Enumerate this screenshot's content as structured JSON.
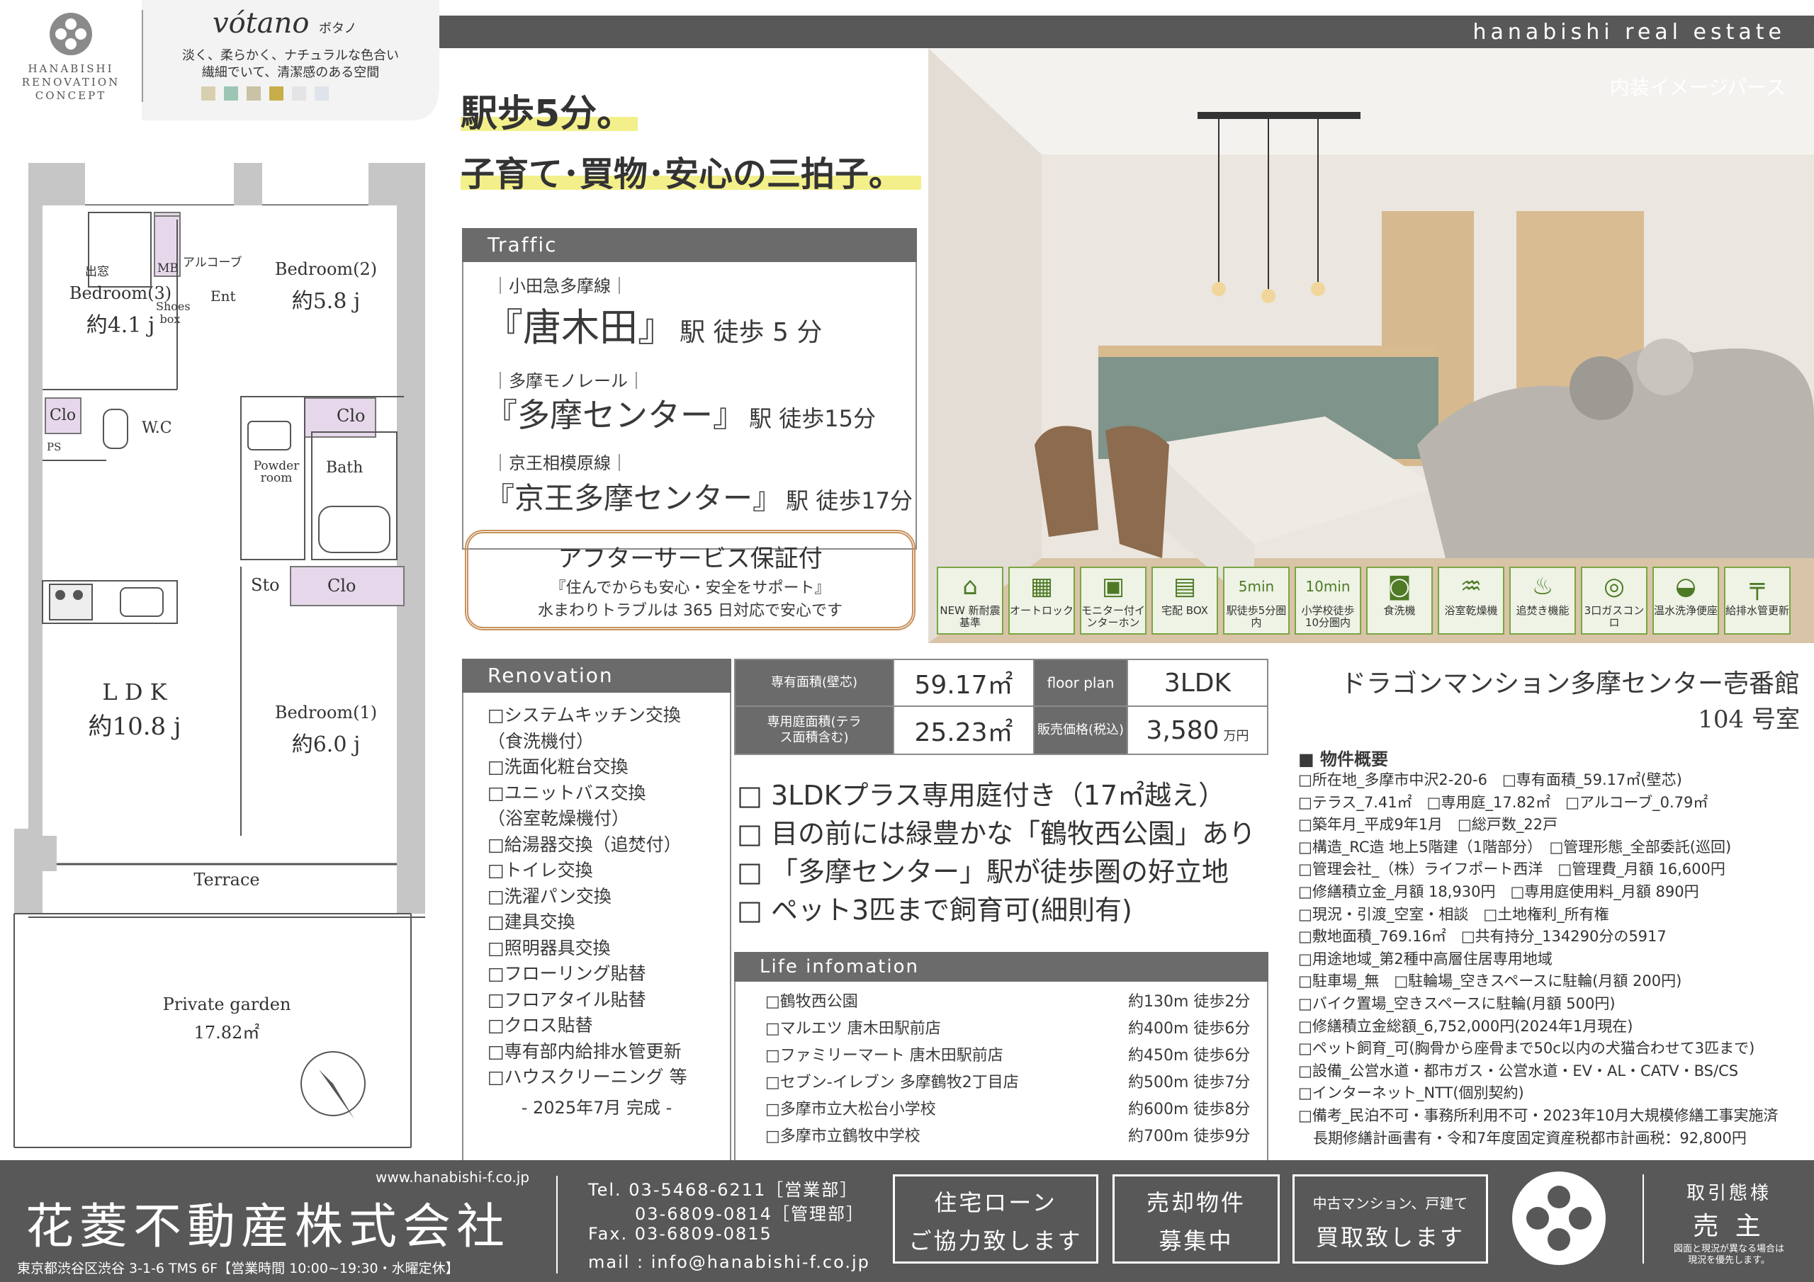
{
  "header": {
    "logo_text": "HANABISHI RENOVATION CONCEPT",
    "concept_name": "vótano",
    "concept_kana": "ボタノ",
    "concept_desc_1": "淡く、柔らかく、ナチュラルな色合い",
    "concept_desc_2": "繊細でいて、清潔感のある空間",
    "swatches": [
      "#d8cfae",
      "#9cc6b3",
      "#c9c2a4",
      "#c8ad4b",
      "#e4e4e6",
      "#dfe3ec"
    ],
    "brand": "hanabishi real estate"
  },
  "headline": {
    "line1": "駅歩5分。",
    "line2": "子育て･買物･安心の三拍子。"
  },
  "traffic": {
    "title": "Traffic",
    "lines": [
      {
        "name": "｜小田急多摩線｜",
        "station": "『唐木田』",
        "suffix": "駅 徒歩 5 分"
      },
      {
        "name": "｜多摩モノレール｜",
        "station": "『多摩センター』",
        "suffix": "駅 徒歩15分"
      },
      {
        "name": "｜京王相模原線｜",
        "station": "『京王多摩センター』",
        "suffix": "駅 徒歩17分"
      }
    ]
  },
  "after_service": {
    "title": "アフターサービス保証付",
    "line1": "『住んでからも安心・安全をサポート』",
    "line2": "水まわりトラブルは 365 日対応で安心です"
  },
  "photo": {
    "caption": "内装イメージパース"
  },
  "features": [
    {
      "icon": "house-icon",
      "glyph": "⌂",
      "label": "NEW 新耐震基準"
    },
    {
      "icon": "lock-icon",
      "glyph": "▦",
      "label": "オートロック"
    },
    {
      "icon": "intercom-icon",
      "glyph": "▣",
      "label": "モニター付インターホン"
    },
    {
      "icon": "box-icon",
      "glyph": "▤",
      "label": "宅配 BOX"
    },
    {
      "icon": "walk-icon",
      "glyph": "5min",
      "label": "駅徒歩5分圏内"
    },
    {
      "icon": "school-icon",
      "glyph": "10min",
      "label": "小学校徒歩10分圏内"
    },
    {
      "icon": "dishwasher-icon",
      "glyph": "◙",
      "label": "食洗機"
    },
    {
      "icon": "dryer-icon",
      "glyph": "♒",
      "label": "浴室乾燥機"
    },
    {
      "icon": "reheat-icon",
      "glyph": "♨",
      "label": "追焚き機能"
    },
    {
      "icon": "stove-icon",
      "glyph": "◎",
      "label": "3口ガスコンロ"
    },
    {
      "icon": "toilet-icon",
      "glyph": "◒",
      "label": "温水洗浄便座"
    },
    {
      "icon": "pipe-icon",
      "glyph": "╤",
      "label": "給排水管更新"
    }
  ],
  "floorplan": {
    "rooms": {
      "bedroom3": "Bedroom(3)",
      "bedroom3_size": "約4.1 j",
      "bedroom2": "Bedroom(2)",
      "bedroom2_size": "約5.8 j",
      "bedroom1": "Bedroom(1)",
      "bedroom1_size": "約6.0 j",
      "ldk": "L D K",
      "ldk_size": "約10.8 j",
      "window": "出窓",
      "mb": "MB",
      "alcove": "アルコーブ",
      "ent": "Ent",
      "shoes": "Shoes box",
      "clo1": "Clo",
      "clo2": "Clo",
      "clo3": "Clo",
      "ps": "PS",
      "wc": "W.C",
      "powder": "Powder room",
      "bath": "Bath",
      "sto": "Sto",
      "terrace": "Terrace",
      "garden": "Private garden",
      "garden_size": "17.82㎡"
    }
  },
  "renovation": {
    "title": "Renovation",
    "items": [
      "□システムキッチン交換",
      "（食洗機付）",
      "□洗面化粧台交換",
      "□ユニットバス交換",
      "（浴室乾燥機付）",
      "□給湯器交換（追焚付）",
      "□トイレ交換",
      "□洗濯パン交換",
      "□建具交換",
      "□照明器具交換",
      "□フローリング貼替",
      "□フロアタイル貼替",
      "□クロス貼替",
      "□専有部内給排水管更新",
      "□ハウスクリーニング 等"
    ],
    "completed": "- 2025年7月 完成 -"
  },
  "specs": {
    "area_label": "専有面積(壁芯)",
    "area_value": "59.17㎡",
    "plan_label": "floor plan",
    "plan_value": "3LDK",
    "garden_label": "専用庭面積(テラス面積含む)",
    "garden_value": "25.23㎡",
    "price_label": "販売価格(税込)",
    "price_value": "3,580",
    "price_unit": "万円"
  },
  "points": [
    "□ 3LDKプラス専用庭付き（17㎡越え）",
    "□ 目の前には緑豊かな「鶴牧西公園」あり",
    "□ 「多摩センター」駅が徒歩圏の好立地",
    "□ ペット3匹まで飼育可(細則有)"
  ],
  "life": {
    "title": "Life infomation",
    "items": [
      {
        "name": "□鶴牧西公園",
        "dist": "約130m 徒歩2分"
      },
      {
        "name": "□マルエツ 唐木田駅前店",
        "dist": "約400m 徒歩6分"
      },
      {
        "name": "□ファミリーマート 唐木田駅前店",
        "dist": "約450m 徒歩6分"
      },
      {
        "name": "□セブン-イレブン 多摩鶴牧2丁目店",
        "dist": "約500m 徒歩7分"
      },
      {
        "name": "□多摩市立大松台小学校",
        "dist": "約600m 徒歩8分"
      },
      {
        "name": "□多摩市立鶴牧中学校",
        "dist": "約700m 徒歩9分"
      }
    ]
  },
  "property": {
    "name": "ドラゴンマンション多摩センター壱番館",
    "room": "104 号室",
    "summary_title": "■ 物件概要",
    "lines": [
      "□所在地_多摩市中沢2-20-6　□専有面積_59.17㎡(壁芯)",
      "□テラス_7.41㎡　□専用庭_17.82㎡　□アルコーブ_0.79㎡",
      "□築年月_平成9年1月　□総戸数_22戸",
      "□構造_RC造 地上5階建（1階部分）　□管理形態_全部委託(巡回)",
      "□管理会社_（株）ライフポート西洋　□管理費_月額 16,600円",
      "□修繕積立金_月額 18,930円　□専用庭使用料_月額 890円",
      "□現況・引渡_空室・相談　□土地権利_所有権",
      "□敷地面積_769.16㎡　□共有持分_134290分の5917",
      "□用途地域_第2種中高層住居専用地域",
      "□駐車場_無　□駐輪場_空きスペースに駐輪(月額 200円)",
      "□バイク置場_空きスペースに駐輪(月額 500円)",
      "□修繕積立金総額_6,752,000円(2024年1月現在)",
      "□ペット飼育_可(胸骨から座骨まで50c以内の犬猫合わせて3匹まで)",
      "□設備_公営水道・都市ガス・公営水道・EV・AL・CATV・BS/CS",
      "□インターネット_NTT(個別契約)",
      "□備考_民泊不可・事務所利用不可・2023年10月大規模修繕工事実施済",
      "　長期修繕計画書有・令和7年度固定資産税都市計画税：92,800円"
    ]
  },
  "footer": {
    "url": "www.hanabishi-f.co.jp",
    "company": "花菱不動産株式会社",
    "address": "東京都渋谷区渋谷 3-1-6 TMS 6F【営業時間 10:00~19:30・水曜定休】",
    "tel1": "Tel. 03-5468-6211［営業部］",
    "tel2": "03-6809-0814［管理部］",
    "fax": "Fax. 03-6809-0815",
    "mail": "mail : info@hanabishi-f.co.jp",
    "box1_l1": "住宅ローン",
    "box1_l2": "ご協力致します",
    "box2_l1": "売却物件",
    "box2_l2": "募集中",
    "box3_l1": "中古マンション、戸建て",
    "box3_l2": "買取致します",
    "deal_label": "取引態様",
    "deal_value": "売 主",
    "note_1": "図面と現況が異なる場合は",
    "note_2": "現況を優先します。"
  }
}
